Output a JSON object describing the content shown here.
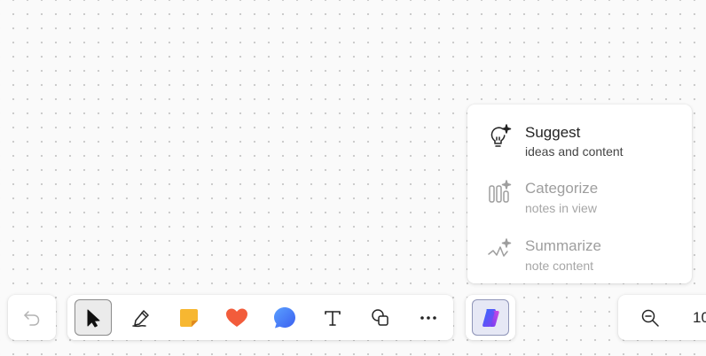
{
  "copilot_menu": {
    "items": [
      {
        "title": "Suggest",
        "subtitle": "ideas and content",
        "icon": "lightbulb-sparkle-icon",
        "enabled": true
      },
      {
        "title": "Categorize",
        "subtitle": "notes in view",
        "icon": "columns-sparkle-icon",
        "enabled": false
      },
      {
        "title": "Summarize",
        "subtitle": "note content",
        "icon": "line-sparkle-icon",
        "enabled": false
      }
    ]
  },
  "toolbar": {
    "undo": {
      "icon": "undo-icon",
      "enabled": false
    },
    "tools": [
      {
        "name": "select",
        "icon": "pointer-icon",
        "selected": true
      },
      {
        "name": "pen",
        "icon": "pen-icon"
      },
      {
        "name": "sticky-note",
        "icon": "sticky-note-icon",
        "color": "#f7b731"
      },
      {
        "name": "reaction",
        "icon": "heart-icon",
        "color": "#f25c3b"
      },
      {
        "name": "comment",
        "icon": "comment-icon",
        "color": "#4a7ff7"
      },
      {
        "name": "text",
        "icon": "text-icon"
      },
      {
        "name": "shapes",
        "icon": "shapes-icon"
      },
      {
        "name": "more",
        "icon": "more-icon"
      }
    ],
    "copilot": {
      "icon": "copilot-icon",
      "selected": true
    }
  },
  "zoom": {
    "icon": "zoom-out-icon",
    "value": "10"
  },
  "colors": {
    "canvas_background": "#fafafa",
    "grid_dot": "#c9c9c9",
    "text_primary": "#242424",
    "text_disabled": "#9e9e9e"
  }
}
